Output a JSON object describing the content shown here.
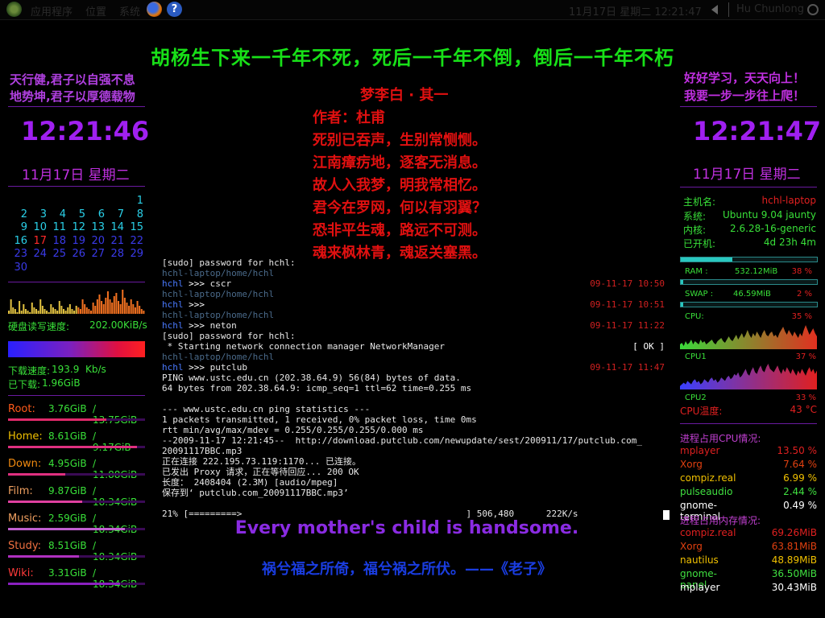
{
  "panel": {
    "menus": [
      "应用程序",
      "位置",
      "系统"
    ],
    "clock": "11月17日 星期二 12:21:47",
    "user": "Hu Chunlong"
  },
  "banner": "胡杨生下来一千年不死，死后一千年不倒，倒后一千年不朽",
  "poem": {
    "title": "梦李白 · 其一",
    "lines": [
      "作者：杜甫",
      "死别已吞声，生别常恻恻。",
      "江南瘴疠地，逐客无消息。",
      "故人入我梦，明我常相忆。",
      "君今在罗网，何以有羽翼？",
      "恐非平生魂，路远不可测。",
      "魂来枫林青，魂返关塞黑。"
    ]
  },
  "left": {
    "motto": [
      "天行健,君子以自强不息",
      "地势坤,君子以厚德载物"
    ],
    "time": "12:21:46",
    "date": "11月17日 星期二",
    "calendar": {
      "weeks": [
        [
          "",
          "",
          "",
          "",
          "",
          "",
          "1"
        ],
        [
          "2",
          "3",
          "4",
          "5",
          "6",
          "7",
          "8"
        ],
        [
          "9",
          "10",
          "11",
          "12",
          "13",
          "14",
          "15"
        ],
        [
          "16",
          "17",
          "18",
          "19",
          "20",
          "21",
          "22"
        ],
        [
          "23",
          "24",
          "25",
          "26",
          "27",
          "28",
          "29"
        ],
        [
          "30",
          "",
          "",
          "",
          "",
          "",
          ""
        ]
      ],
      "today": "17",
      "color_past": "#2ad0e8",
      "color_today": "#ff2a2a",
      "color_future": "#3a3ae8"
    },
    "disk_io_label": "硬盘读写速度:",
    "disk_io_value": "202.00KiB/s",
    "down_speed_label": "下载速度:",
    "down_speed_value": "193.9",
    "down_speed_unit": "Kb/s",
    "downloaded_label": "已下载:",
    "downloaded_value": "1.96GiB",
    "disks": [
      {
        "name": "Root:",
        "used": "3.76GiB",
        "total": "/ 13.75GiB",
        "usage": 0.72,
        "color": "#ff5a1a",
        "bar": "#e02a6a"
      },
      {
        "name": "Home:",
        "used": "8.61GiB",
        "total": "/ 9.17GiB",
        "usage": 0.94,
        "color": "#f0c000",
        "bar": "#e03080"
      },
      {
        "name": "Down:",
        "used": "4.95GiB",
        "total": "/ 11.88GiB",
        "usage": 0.42,
        "color": "#f08a10",
        "bar": "#e03080"
      },
      {
        "name": "Film:",
        "used": "9.87GiB",
        "total": "/ 18.34GiB",
        "usage": 0.54,
        "color": "#f0a060",
        "bar": "#e040a0"
      },
      {
        "name": "Music:",
        "used": "2.59GiB",
        "total": "/ 18.34GiB",
        "usage": 0.85,
        "color": "#f0a060",
        "bar": "#c060d0"
      },
      {
        "name": "Study:",
        "used": "8.51GiB",
        "total": "/ 18.34GiB",
        "usage": 0.52,
        "color": "#f07040",
        "bar": "#b030c0"
      },
      {
        "name": "Wiki:",
        "used": "3.31GiB",
        "total": "/ 18.34GiB",
        "usage": 0.82,
        "color": "#ff3a3a",
        "bar": "#8a20c0"
      }
    ]
  },
  "terminal": {
    "lines": [
      {
        "t": "[sudo] password for hchl:",
        "c": ""
      },
      {
        "t": "hchl-laptop/home/hchl",
        "c": "c-grey"
      },
      {
        "t": "hchl >>> cscr",
        "c": "prompt",
        "time": "09-11-17 10:50"
      },
      {
        "t": "hchl-laptop/home/hchl",
        "c": "c-grey"
      },
      {
        "t": "hchl >>>",
        "c": "prompt",
        "time": "09-11-17 10:51"
      },
      {
        "t": "hchl-laptop/home/hchl",
        "c": "c-grey"
      },
      {
        "t": "hchl >>> neton",
        "c": "prompt",
        "time": "09-11-17 11:22"
      },
      {
        "t": "[sudo] password for hchl:",
        "c": ""
      },
      {
        "t": " * Starting network connection manager NetworkManager",
        "c": "",
        "time": "[ OK ]",
        "tc": "c-yel"
      },
      {
        "t": "hchl-laptop/home/hchl",
        "c": "c-grey"
      },
      {
        "t": "hchl >>> putclub",
        "c": "prompt",
        "time": "09-11-17 11:47"
      },
      {
        "t": "PING www.ustc.edu.cn (202.38.64.9) 56(84) bytes of data.",
        "c": ""
      },
      {
        "t": "64 bytes from 202.38.64.9: icmp_seq=1 ttl=62 time=0.255 ms",
        "c": ""
      },
      {
        "t": "",
        "c": ""
      },
      {
        "t": "--- www.ustc.edu.cn ping statistics ---",
        "c": ""
      },
      {
        "t": "1 packets transmitted, 1 received, 0% packet loss, time 0ms",
        "c": ""
      },
      {
        "t": "rtt min/avg/max/mdev = 0.255/0.255/0.255/0.000 ms",
        "c": ""
      },
      {
        "t": "--2009-11-17 12:21:45--  http://download.putclub.com/newupdate/sest/200911/17/putclub.com_",
        "c": ""
      },
      {
        "t": "20091117BBC.mp3",
        "c": ""
      },
      {
        "t": "正在连接 222.195.73.119:1170... 已连接。",
        "c": ""
      },
      {
        "t": "已发出 Proxy 请求，正在等待回应... 200 OK",
        "c": ""
      },
      {
        "t": "长度： 2408404 (2.3M) [audio/mpeg]",
        "c": ""
      },
      {
        "t": "保存到‘ putclub.com_20091117BBC.mp3’",
        "c": ""
      },
      {
        "t": "",
        "c": ""
      },
      {
        "t": "21% [=========>                                          ] 506,480      222K/s",
        "c": ""
      }
    ]
  },
  "english": "Every mother's child is handsome.",
  "laozi": "祸兮福之所倚，福兮祸之所伏。——《老子》",
  "right": {
    "motto": [
      "好好学习，天天向上！",
      "我要一步一步往上爬！"
    ],
    "time": "12:21:47",
    "date": "11月17日 星期二",
    "sys": [
      {
        "k": "主机名:",
        "v": "hchl-laptop",
        "red": true
      },
      {
        "k": "系统:",
        "v": "Ubuntu 9.04 jaunty",
        "red": false
      },
      {
        "k": "内核:",
        "v": "2.6.28-16-generic",
        "red": false
      },
      {
        "k": "已开机:",
        "v": "4d 23h 4m",
        "red": false
      }
    ],
    "ram": {
      "label": "RAM :",
      "value": "532.12MiB",
      "pct": "38 %",
      "frac": 0.38
    },
    "swap": {
      "label": "SWAP :",
      "value": "46.59MiB",
      "pct": "2 %",
      "frac": 0.02
    },
    "cpu": [
      {
        "label": "CPU:",
        "pct": "35 %"
      },
      {
        "label": "CPU1",
        "pct": "37 %"
      },
      {
        "label": "CPU2",
        "pct": "33 %"
      }
    ],
    "temp_label": "CPU温度:",
    "temp_value": "43 °C",
    "proc_cpu_header": "进程占用CPU情况:",
    "proc_cpu": [
      {
        "n": "mplayer",
        "v": "13.50 %",
        "c": "#e02020"
      },
      {
        "n": "Xorg",
        "v": "7.64 %",
        "c": "#e04010"
      },
      {
        "n": "compiz.real",
        "v": "6.99 %",
        "c": "#f0c000"
      },
      {
        "n": "pulseaudio",
        "v": "2.44 %",
        "c": "#40e040"
      },
      {
        "n": "gnome-terminal",
        "v": "0.49 %",
        "c": "#ffffff"
      }
    ],
    "proc_mem_header": "进程占用内存情况:",
    "proc_mem": [
      {
        "n": "compiz.real",
        "v": "69.26MiB",
        "c": "#e02020"
      },
      {
        "n": "Xorg",
        "v": "63.81MiB",
        "c": "#e04010"
      },
      {
        "n": "nautilus",
        "v": "48.89MiB",
        "c": "#f0c000"
      },
      {
        "n": "gnome-panel",
        "v": "36.50MiB",
        "c": "#40e040"
      },
      {
        "n": "mplayer",
        "v": "30.43MiB",
        "c": "#ffffff"
      }
    ]
  },
  "chart_data": [
    {
      "type": "bar",
      "title": "",
      "series": [
        {
          "values": [
            2,
            9,
            4,
            3,
            1,
            8,
            2,
            6,
            3,
            2,
            1,
            7,
            4,
            3,
            2,
            9,
            5,
            3,
            2,
            1,
            6,
            4,
            3,
            2,
            8,
            5,
            3,
            2,
            4,
            6,
            3,
            2,
            5,
            4,
            3,
            9,
            6,
            4,
            3,
            2,
            7,
            5,
            9,
            12,
            8,
            6,
            10,
            14,
            9,
            7,
            11,
            13,
            8,
            6,
            15,
            10,
            7,
            5,
            9,
            6,
            4,
            8,
            5,
            3,
            2
          ]
        }
      ],
      "xlabel": "",
      "ylabel": ""
    },
    {
      "type": "area",
      "title": "",
      "series": [
        {
          "values": [
            3,
            4,
            2,
            5,
            3,
            4,
            6,
            3,
            5,
            4,
            3,
            6,
            4,
            5,
            3,
            4,
            5,
            6,
            4,
            3,
            5,
            6,
            7,
            5,
            4,
            6,
            8,
            6,
            5,
            7,
            9,
            6,
            8,
            10,
            7,
            9,
            12,
            9,
            7,
            10,
            8,
            11,
            9,
            7,
            10,
            12,
            9,
            8,
            10,
            11,
            8,
            9,
            7,
            10,
            12,
            14,
            11,
            9,
            12,
            10,
            8,
            11,
            9,
            7,
            10,
            8,
            12,
            15,
            12,
            9,
            11,
            13,
            10,
            8
          ]
        }
      ],
      "xlabel": "",
      "ylabel": ""
    },
    {
      "type": "area",
      "title": "",
      "series": [
        {
          "values": [
            2,
            3,
            4,
            3,
            5,
            4,
            3,
            5,
            6,
            4,
            5,
            3,
            4,
            6,
            5,
            4,
            6,
            7,
            5,
            6,
            4,
            5,
            7,
            6,
            5,
            7,
            8,
            6,
            7,
            9,
            8,
            10,
            7,
            8,
            10,
            12,
            9,
            8,
            11,
            13,
            10,
            9,
            12,
            14,
            11,
            10,
            13,
            15,
            12,
            11,
            10,
            12,
            14,
            11,
            9,
            12,
            10,
            13,
            11,
            9,
            12,
            10,
            8,
            11,
            9,
            12,
            10,
            8,
            11,
            13,
            10,
            12,
            9,
            11
          ]
        }
      ],
      "xlabel": "",
      "ylabel": ""
    },
    {
      "type": "area",
      "title": "",
      "series": [
        {
          "values": [
            3,
            2,
            4,
            3,
            2,
            5,
            3,
            4,
            3,
            5,
            4,
            3,
            5,
            4,
            6,
            5,
            4,
            3,
            5,
            6,
            4,
            5,
            6,
            5,
            7,
            6,
            5,
            7,
            6,
            8,
            7,
            6,
            9,
            8,
            10,
            9,
            11,
            10,
            12,
            11,
            13,
            12,
            10,
            11,
            13,
            12,
            11,
            10,
            12,
            11,
            9,
            10,
            8,
            9,
            11,
            10,
            12,
            9,
            8,
            10,
            9,
            11,
            8,
            10,
            9,
            7,
            8,
            10,
            9,
            11,
            8,
            10,
            9,
            7
          ]
        }
      ],
      "xlabel": "",
      "ylabel": ""
    }
  ]
}
